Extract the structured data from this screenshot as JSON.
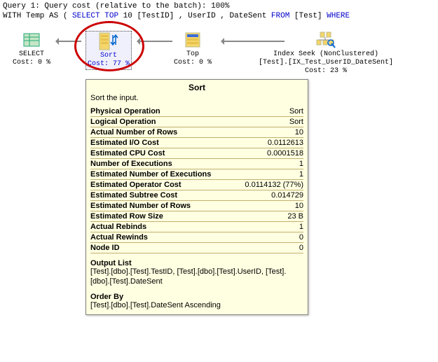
{
  "header": {
    "line1_prefix": "Query 1: Query cost (relative to the batch): ",
    "line1_pct": "100%",
    "line2_prefix": "WITH Temp AS ( ",
    "line2_kw1": "SELECT TOP ",
    "line2_num": "10",
    "line2_cols": " [TestID] , UserID , DateSent ",
    "line2_from": "FROM",
    "line2_tbl": " [Test] ",
    "line2_where": "WHERE"
  },
  "plan": {
    "select": {
      "label": "SELECT",
      "cost": "Cost: 0 %"
    },
    "sort": {
      "label": "Sort",
      "cost": "Cost: 77 %"
    },
    "top": {
      "label": "Top",
      "cost": "Cost: 0 %"
    },
    "seek": {
      "label": "Index Seek (NonClustered)",
      "detail": "[Test].[IX_Test_UserID_DateSent]",
      "cost": "Cost: 23 %"
    }
  },
  "tooltip": {
    "title": "Sort",
    "desc": "Sort the input.",
    "rows": [
      {
        "k": "Physical Operation",
        "v": "Sort"
      },
      {
        "k": "Logical Operation",
        "v": "Sort"
      },
      {
        "k": "Actual Number of Rows",
        "v": "10"
      },
      {
        "k": "Estimated I/O Cost",
        "v": "0.0112613"
      },
      {
        "k": "Estimated CPU Cost",
        "v": "0.0001518"
      },
      {
        "k": "Number of Executions",
        "v": "1"
      },
      {
        "k": "Estimated Number of Executions",
        "v": "1"
      },
      {
        "k": "Estimated Operator Cost",
        "v": "0.0114132 (77%)"
      },
      {
        "k": "Estimated Subtree Cost",
        "v": "0.014729"
      },
      {
        "k": "Estimated Number of Rows",
        "v": "10"
      },
      {
        "k": "Estimated Row Size",
        "v": "23 B"
      },
      {
        "k": "Actual Rebinds",
        "v": "1"
      },
      {
        "k": "Actual Rewinds",
        "v": "0"
      },
      {
        "k": "Node ID",
        "v": "0"
      }
    ],
    "outputTitle": "Output List",
    "outputBody": "[Test].[dbo].[Test].TestID, [Test].[dbo].[Test].UserID, [Test].[dbo].[Test].DateSent",
    "orderTitle": "Order By",
    "orderBody": "[Test].[dbo].[Test].DateSent Ascending"
  }
}
